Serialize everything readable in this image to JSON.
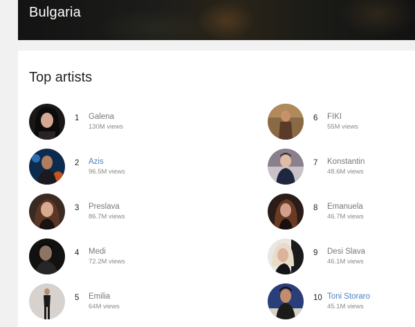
{
  "banner": {
    "title": "Bulgaria"
  },
  "top_artists": {
    "title": "Top artists",
    "artists": [
      {
        "rank": "1",
        "name": "Galena",
        "views": "130M views",
        "linked": false
      },
      {
        "rank": "2",
        "name": "Azis",
        "views": "96.5M views",
        "linked": true
      },
      {
        "rank": "3",
        "name": "Preslava",
        "views": "86.7M views",
        "linked": false
      },
      {
        "rank": "4",
        "name": "Medi",
        "views": "72.2M views",
        "linked": false
      },
      {
        "rank": "5",
        "name": "Emilia",
        "views": "64M views",
        "linked": false
      },
      {
        "rank": "6",
        "name": "FIKI",
        "views": "55M views",
        "linked": false
      },
      {
        "rank": "7",
        "name": "Konstantin",
        "views": "48.6M views",
        "linked": false
      },
      {
        "rank": "8",
        "name": "Emanuela",
        "views": "46.7M views",
        "linked": false
      },
      {
        "rank": "9",
        "name": "Desi Slava",
        "views": "46.1M views",
        "linked": false
      },
      {
        "rank": "10",
        "name": "Toni Storaro",
        "views": "45.1M views",
        "linked": true
      }
    ]
  },
  "colors": {
    "link": "#4a7fc1",
    "muted": "#777777"
  }
}
